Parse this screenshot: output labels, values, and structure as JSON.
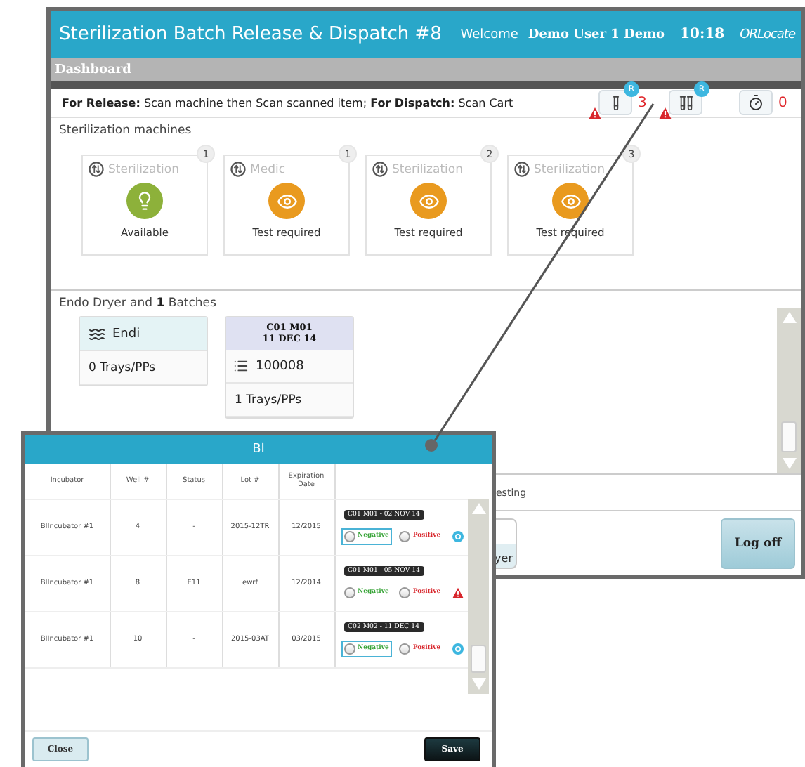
{
  "window": {
    "title": "Sterilization Batch Release & Dispatch #8",
    "welcome_label": "Welcome",
    "user": "Demo User 1 Demo",
    "time": "10:18",
    "logo": "ORLocate"
  },
  "nav": {
    "title": "Dashboard"
  },
  "instructions": "**For Release:** Scan machine then Scan scanned item;  **For Dispatch:** Scan Cart",
  "indicators": [
    {
      "kind": "tube",
      "badge": "R",
      "warning": true,
      "count": "3"
    },
    {
      "kind": "tubes",
      "badge": "R",
      "warning": true
    },
    {
      "kind": "timer",
      "count": "0"
    }
  ],
  "machines_section": {
    "title": "Sterilization machines",
    "machines": [
      {
        "number": "1",
        "name": "Sterilization",
        "kind": "available",
        "status": "Available"
      },
      {
        "number": "1",
        "name": "Medic",
        "kind": "test",
        "status": "Test required"
      },
      {
        "number": "2",
        "name": "Sterilization",
        "kind": "test",
        "status": "Test required"
      },
      {
        "number": "3",
        "name": "Sterilization",
        "kind": "test",
        "status": "Test required"
      }
    ]
  },
  "dryer_section": {
    "title": "Endo Dryer and **1** Batches",
    "dryer": {
      "name": "Endi",
      "trays": "0 Trays/PPs"
    },
    "batches": [
      {
        "header_lines": [
          "C01 M01",
          "11 DEC 14"
        ],
        "id": "100008",
        "trays": "1 Trays/PPs"
      }
    ]
  },
  "status_text": "esting",
  "buttons": [
    {
      "label": "yer"
    },
    {
      "label": "Log off"
    }
  ],
  "dialog": {
    "title": "BI",
    "columns": [
      "Incubator",
      "Well #",
      "Status",
      "Lot #",
      "Expiration Date"
    ],
    "rows": [
      {
        "incubator": "BIIncubator #1",
        "well": "4",
        "status": "-",
        "lot": "2015-12TR",
        "expiration": "12/2015",
        "tag": "C01 M01 - 02 NOV 14",
        "options": [
          {
            "kind": "negative",
            "label": "Negative",
            "selected": true
          },
          {
            "kind": "positive",
            "label": "Positive",
            "selected": false
          }
        ],
        "flag": {
          "kind": "info"
        }
      },
      {
        "incubator": "BIIncubator #1",
        "well": "8",
        "status": "E11",
        "lot": "ewrf",
        "expiration": "12/2014",
        "tag": "C01 M01 - 05 NOV 14",
        "options": [
          {
            "kind": "negative",
            "label": "Negative",
            "selected": false
          },
          {
            "kind": "positive",
            "label": "Positive",
            "selected": false
          }
        ],
        "flag": {
          "kind": "warning"
        }
      },
      {
        "incubator": "BIIncubator #1",
        "well": "10",
        "status": "-",
        "lot": "2015-03AT",
        "expiration": "03/2015",
        "tag": "C02 M02 - 11 DEC 14",
        "options": [
          {
            "kind": "negative",
            "label": "Negative",
            "selected": true
          },
          {
            "kind": "positive",
            "label": "Positive",
            "selected": false
          }
        ],
        "flag": {
          "kind": "info"
        }
      }
    ],
    "buttons": [
      {
        "kind": "secondary",
        "label": "Close"
      },
      {
        "kind": "primary",
        "label": "Save"
      }
    ]
  }
}
